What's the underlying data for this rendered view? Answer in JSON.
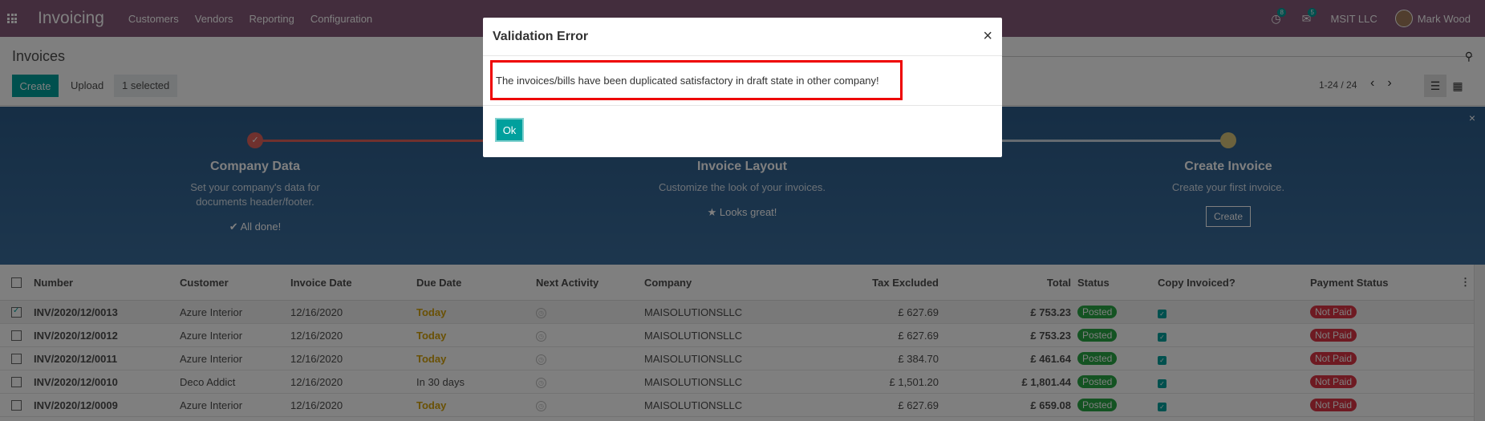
{
  "navbar": {
    "app_title": "Invoicing",
    "menu": [
      "Customers",
      "Vendors",
      "Reporting",
      "Configuration"
    ],
    "activity_count": "8",
    "message_count": "5",
    "company": "MSIT LLC",
    "user_name": "Mark Wood"
  },
  "control_panel": {
    "breadcrumb": "Invoices",
    "create_label": "Create",
    "upload_label": "Upload",
    "selected_label": "1 selected",
    "pager": "1-24 / 24"
  },
  "banner": {
    "steps": [
      {
        "title": "Company Data",
        "desc": "Set your company's data for documents header/footer.",
        "status": "✔ All done!"
      },
      {
        "title": "Invoice Layout",
        "desc": "Customize the look of your invoices.",
        "status": "★ Looks great!"
      },
      {
        "title": "Create Invoice",
        "desc": "Create your first invoice.",
        "button": "Create"
      }
    ]
  },
  "list": {
    "columns": [
      "Number",
      "Customer",
      "Invoice Date",
      "Due Date",
      "Next Activity",
      "Company",
      "Tax Excluded",
      "Total",
      "Status",
      "Copy Invoiced?",
      "Payment Status"
    ],
    "rows": [
      {
        "number": "INV/2020/12/0013",
        "customer": "Azure Interior",
        "invoice_date": "12/16/2020",
        "due_date": "Today",
        "company": "MAISOLUTIONSLLC",
        "tax_excluded": "£ 627.69",
        "total": "£ 753.23",
        "status": "Posted",
        "payment_status": "Not Paid"
      },
      {
        "number": "INV/2020/12/0012",
        "customer": "Azure Interior",
        "invoice_date": "12/16/2020",
        "due_date": "Today",
        "company": "MAISOLUTIONSLLC",
        "tax_excluded": "£ 627.69",
        "total": "£ 753.23",
        "status": "Posted",
        "payment_status": "Not Paid"
      },
      {
        "number": "INV/2020/12/0011",
        "customer": "Azure Interior",
        "invoice_date": "12/16/2020",
        "due_date": "Today",
        "company": "MAISOLUTIONSLLC",
        "tax_excluded": "£ 384.70",
        "total": "£ 461.64",
        "status": "Posted",
        "payment_status": "Not Paid"
      },
      {
        "number": "INV/2020/12/0010",
        "customer": "Deco Addict",
        "invoice_date": "12/16/2020",
        "due_date": "In 30 days",
        "company": "MAISOLUTIONSLLC",
        "tax_excluded": "£ 1,501.20",
        "total": "£ 1,801.44",
        "status": "Posted",
        "payment_status": "Not Paid"
      },
      {
        "number": "INV/2020/12/0009",
        "customer": "Azure Interior",
        "invoice_date": "12/16/2020",
        "due_date": "Today",
        "company": "MAISOLUTIONSLLC",
        "tax_excluded": "£ 627.69",
        "total": "£ 659.08",
        "status": "Posted",
        "payment_status": "Not Paid"
      }
    ]
  },
  "modal": {
    "title": "Validation Error",
    "close": "×",
    "message": "The invoices/bills have been duplicated satisfactory in draft state in other company!",
    "ok_label": "Ok"
  },
  "colors": {
    "navbar": "#875a7b",
    "primary": "#00a09d",
    "banner": "#2c5c8a",
    "due_today": "#d4a20b",
    "posted": "#28a745",
    "not_paid": "#dc3545",
    "highlight": "#ee0000"
  }
}
